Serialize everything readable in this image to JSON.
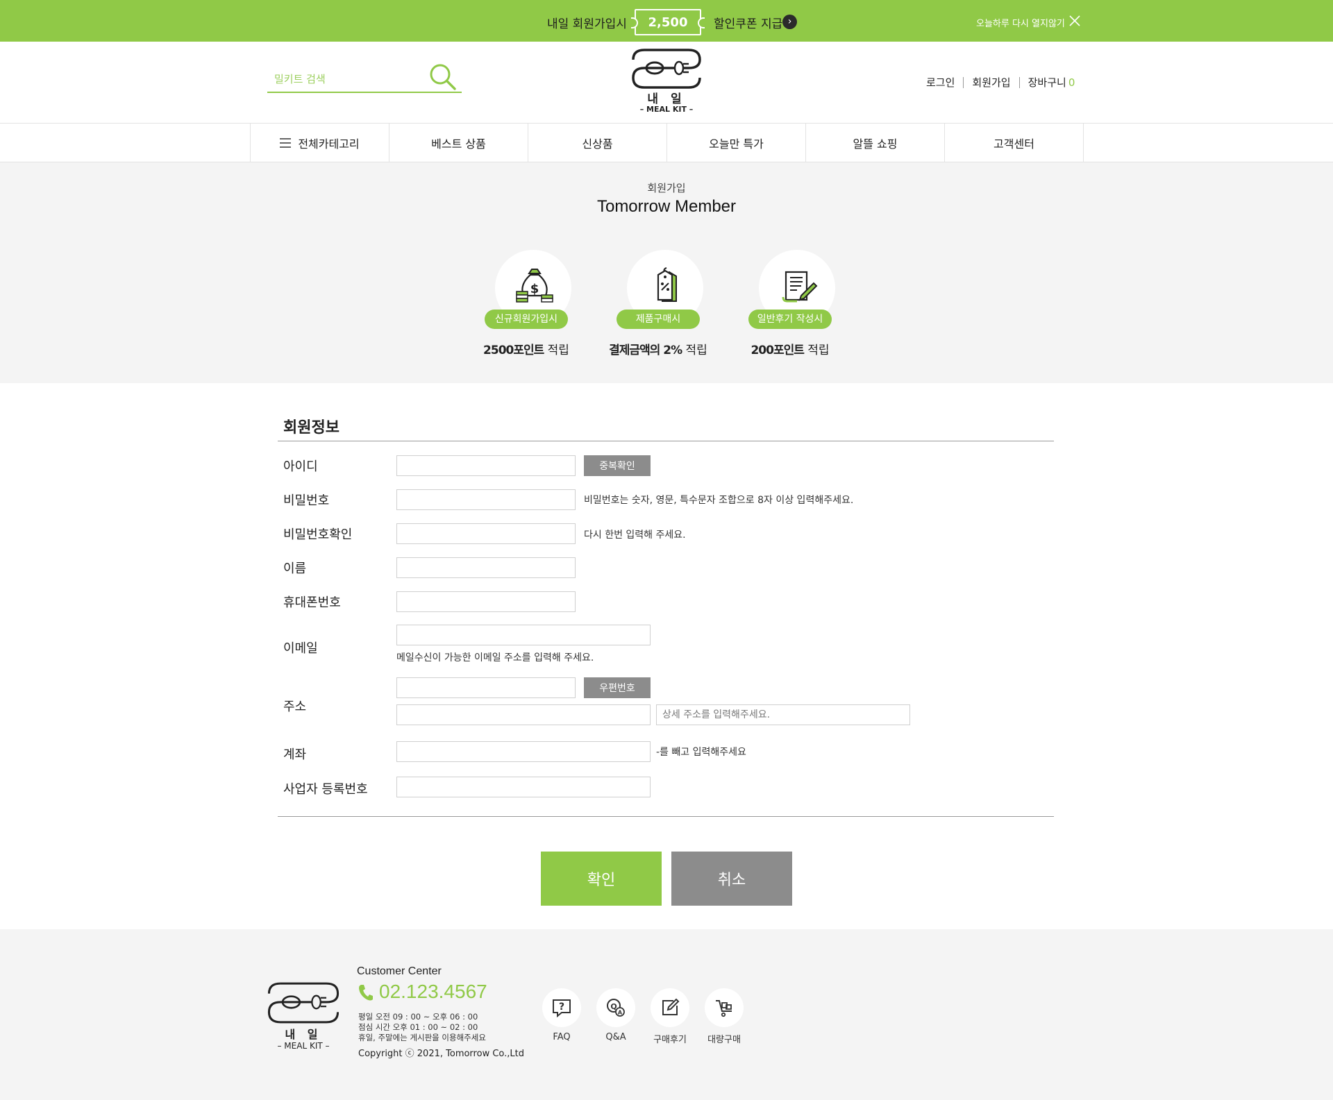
{
  "topbar": {
    "promo_prefix": "내일 회원가입시",
    "coupon_amount": "2,500",
    "promo_suffix": "할인쿠폰 지급",
    "dismiss": "오늘하루 다시 열지않기"
  },
  "header": {
    "search_placeholder": "밀키트 검색",
    "logo_text": "내  일",
    "logo_sub": "– MEAL KIT –",
    "login": "로그인",
    "signup": "회원가입",
    "cart": "장바구니",
    "cart_count": "0"
  },
  "nav": {
    "items": [
      "전체카테고리",
      "베스트 상품",
      "신상품",
      "오늘만 특가",
      "알뜰 쇼핑",
      "고객센터"
    ]
  },
  "hero": {
    "subtitle": "회원가입",
    "title": "Tomorrow Member",
    "benefits": [
      {
        "pill": "신규회원가입시",
        "bold": "2500포인트",
        "rest": " 적립",
        "icon": "money-bag-icon"
      },
      {
        "pill": "제품구매시",
        "bold": "결제금액의 2%",
        "rest": " 적립",
        "icon": "price-tag-icon"
      },
      {
        "pill": "일반후기 작성시",
        "bold": "200포인트",
        "rest": " 적립",
        "icon": "review-document-icon"
      }
    ]
  },
  "form": {
    "section_title": "회원정보",
    "labels": {
      "id": "아이디",
      "password": "비밀번호",
      "password_confirm": "비밀번호확인",
      "name": "이름",
      "phone": "휴대폰번호",
      "email": "이메일",
      "address": "주소",
      "account": "계좌",
      "business": "사업자 등록번호"
    },
    "id_check_button": "중복확인",
    "password_hint": "비밀번호는 숫자, 영문, 특수문자 조합으로 8자 이상 입력해주세요.",
    "password_confirm_hint": "다시 한번 입력해 주세요.",
    "email_hint": "메일수신이 가능한 이메일 주소를 입력해 주세요.",
    "zipcode_button": "우편번호",
    "address_detail_placeholder": "상세 주소를 입력해주세요.",
    "account_hint": "-를 빼고 입력해주세요",
    "submit": "확인",
    "cancel": "취소"
  },
  "footer": {
    "logo_text": "내  일",
    "logo_sub": "– MEAL KIT –",
    "cc_title": "Customer Center",
    "phone": "02.123.4567",
    "hours": [
      "평일 오전 09 : 00 ~ 오후 06 : 00",
      "점심 시간 오후 01 : 00 ~ 02 : 00",
      "휴일, 주말에는 게시판을 이용해주세요"
    ],
    "copyright": "Copyright ⓒ 2021, Tomorrow Co.,Ltd",
    "links": [
      {
        "label": "FAQ",
        "icon": "faq-icon"
      },
      {
        "label": "Q&A",
        "icon": "qna-icon"
      },
      {
        "label": "구매후기",
        "icon": "review-icon"
      },
      {
        "label": "대량구매",
        "icon": "bulk-order-icon"
      }
    ]
  },
  "colors": {
    "accent": "#90c947",
    "gray_button": "#8c8c8c",
    "hero_bg": "#f4f4f4"
  }
}
